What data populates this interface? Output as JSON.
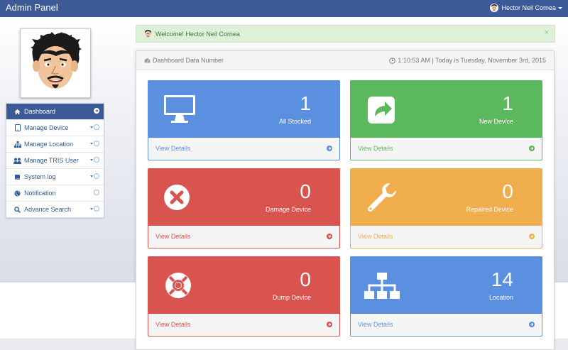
{
  "header": {
    "brand": "Admin Panel",
    "user_name": "Hector Neil Cornea"
  },
  "sidebar": {
    "items": [
      {
        "label": "Dashboard",
        "icon": "home-icon",
        "active": true
      },
      {
        "label": "Manage Device",
        "icon": "tablet-icon"
      },
      {
        "label": "Manage Location",
        "icon": "sitemap-icon"
      },
      {
        "label": "Manage TRIS User",
        "icon": "users-icon"
      },
      {
        "label": "System log",
        "icon": "book-icon"
      },
      {
        "label": "Notification",
        "icon": "globe-icon"
      },
      {
        "label": "Advance Search",
        "icon": "search-icon"
      }
    ]
  },
  "alert": {
    "message": "Welcome! Hector Neil Cornea",
    "close": "×"
  },
  "panel": {
    "title": "Dashboard Data Number",
    "datetime": "1:10:53 AM  | Today is Tuesday, November 3rd, 2015"
  },
  "cards": [
    {
      "value": "1",
      "label": "All Stocked",
      "link": "View Details",
      "icon": "desktop-icon",
      "color": "#5b8fe0"
    },
    {
      "value": "1",
      "label": "New Device",
      "link": "View Details",
      "icon": "share-icon",
      "color": "#5cb85c"
    },
    {
      "value": "0",
      "label": "Damage Device",
      "link": "View Details",
      "icon": "times-circle-icon",
      "color": "#d9534f"
    },
    {
      "value": "0",
      "label": "Repaired Device",
      "link": "View Details",
      "icon": "wrench-icon",
      "color": "#f0ad4e"
    },
    {
      "value": "0",
      "label": "Dump Device",
      "link": "View Details",
      "icon": "life-ring-icon",
      "color": "#d9534f"
    },
    {
      "value": "14",
      "label": "Location",
      "link": "View Details",
      "icon": "sitemap-icon",
      "color": "#5b8fe0"
    }
  ]
}
